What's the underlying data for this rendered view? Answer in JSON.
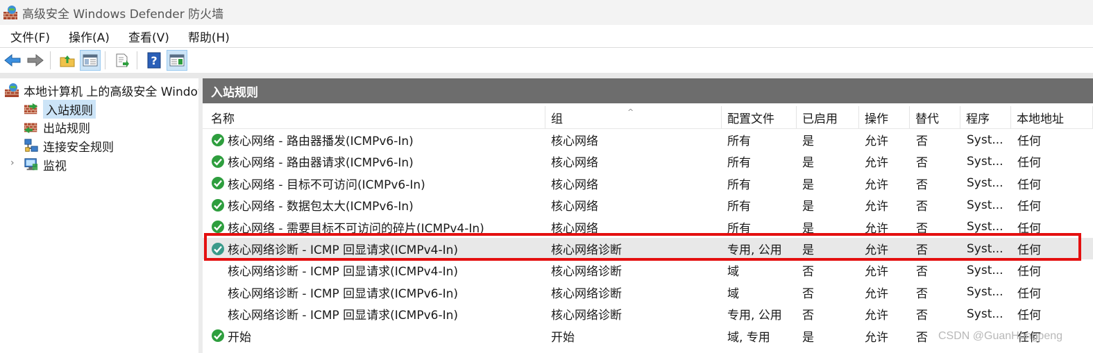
{
  "window": {
    "title": "高级安全 Windows Defender 防火墙",
    "icon": "firewall-globe-icon"
  },
  "menu": [
    "文件(F)",
    "操作(A)",
    "查看(V)",
    "帮助(H)"
  ],
  "toolbar": {
    "buttons": [
      {
        "name": "back-icon",
        "active": false
      },
      {
        "name": "forward-icon",
        "active": false
      },
      {
        "name": "up-folder-icon",
        "active": false
      },
      {
        "name": "show-hide-tree-icon",
        "active": true
      },
      {
        "name": "export-list-icon",
        "active": false
      },
      {
        "name": "help-icon",
        "active": false
      },
      {
        "name": "show-hide-action-pane-icon",
        "active": true
      }
    ]
  },
  "tree": {
    "root": "本地计算机 上的高级安全 Windows Defender 防火墙",
    "items": [
      {
        "label": "入站规则",
        "selected": true,
        "icon": "inbound-rules-icon"
      },
      {
        "label": "出站规则",
        "selected": false,
        "icon": "outbound-rules-icon"
      },
      {
        "label": "连接安全规则",
        "selected": false,
        "icon": "connection-security-icon"
      },
      {
        "label": "监视",
        "selected": false,
        "icon": "monitoring-icon",
        "expander": "›"
      }
    ]
  },
  "pane": {
    "title": "入站规则",
    "columns": [
      "名称",
      "组",
      "配置文件",
      "已启用",
      "操作",
      "替代",
      "程序",
      "本地地址"
    ],
    "sort_indicator": "^"
  },
  "rules": [
    {
      "name": "核心网络 - 路由器播发(ICMPv6-In)",
      "group": "核心网络",
      "profile": "所有",
      "enabled": "是",
      "action": "允许",
      "override": "否",
      "program": "Syst...",
      "local": "任何",
      "status": "enabled"
    },
    {
      "name": "核心网络 - 路由器请求(ICMPv6-In)",
      "group": "核心网络",
      "profile": "所有",
      "enabled": "是",
      "action": "允许",
      "override": "否",
      "program": "Syst...",
      "local": "任何",
      "status": "enabled"
    },
    {
      "name": "核心网络 - 目标不可访问(ICMPv6-In)",
      "group": "核心网络",
      "profile": "所有",
      "enabled": "是",
      "action": "允许",
      "override": "否",
      "program": "Syst...",
      "local": "任何",
      "status": "enabled"
    },
    {
      "name": "核心网络 - 数据包太大(ICMPv6-In)",
      "group": "核心网络",
      "profile": "所有",
      "enabled": "是",
      "action": "允许",
      "override": "否",
      "program": "Syst...",
      "local": "任何",
      "status": "enabled"
    },
    {
      "name": "核心网络 - 需要目标不可访问的碎片(ICMPv4-In)",
      "group": "核心网络",
      "profile": "所有",
      "enabled": "是",
      "action": "允许",
      "override": "否",
      "program": "Syst...",
      "local": "任何",
      "status": "enabled"
    },
    {
      "name": "核心网络诊断 - ICMP 回显请求(ICMPv4-In)",
      "group": "核心网络诊断",
      "profile": "专用, 公用",
      "enabled": "是",
      "action": "允许",
      "override": "否",
      "program": "Syst...",
      "local": "任何",
      "status": "enabled-selected"
    },
    {
      "name": "核心网络诊断 - ICMP 回显请求(ICMPv4-In)",
      "group": "核心网络诊断",
      "profile": "域",
      "enabled": "否",
      "action": "允许",
      "override": "否",
      "program": "Syst...",
      "local": "任何",
      "status": "disabled"
    },
    {
      "name": "核心网络诊断 - ICMP 回显请求(ICMPv6-In)",
      "group": "核心网络诊断",
      "profile": "域",
      "enabled": "否",
      "action": "允许",
      "override": "否",
      "program": "Syst...",
      "local": "任何",
      "status": "disabled"
    },
    {
      "name": "核心网络诊断 - ICMP 回显请求(ICMPv6-In)",
      "group": "核心网络诊断",
      "profile": "专用, 公用",
      "enabled": "否",
      "action": "允许",
      "override": "否",
      "program": "Syst...",
      "local": "任何",
      "status": "disabled"
    },
    {
      "name": "开始",
      "group": "开始",
      "profile": "域, 专用",
      "enabled": "是",
      "action": "允许",
      "override": "否",
      "program": "",
      "local": "任何",
      "status": "enabled"
    }
  ],
  "watermark": "CSDN @GuanHongpeng",
  "colors": {
    "pane_header": "#6d6d6d",
    "selection": "#cce4f7",
    "highlight_box": "#e41010",
    "check_green": "#2e9e3e"
  }
}
